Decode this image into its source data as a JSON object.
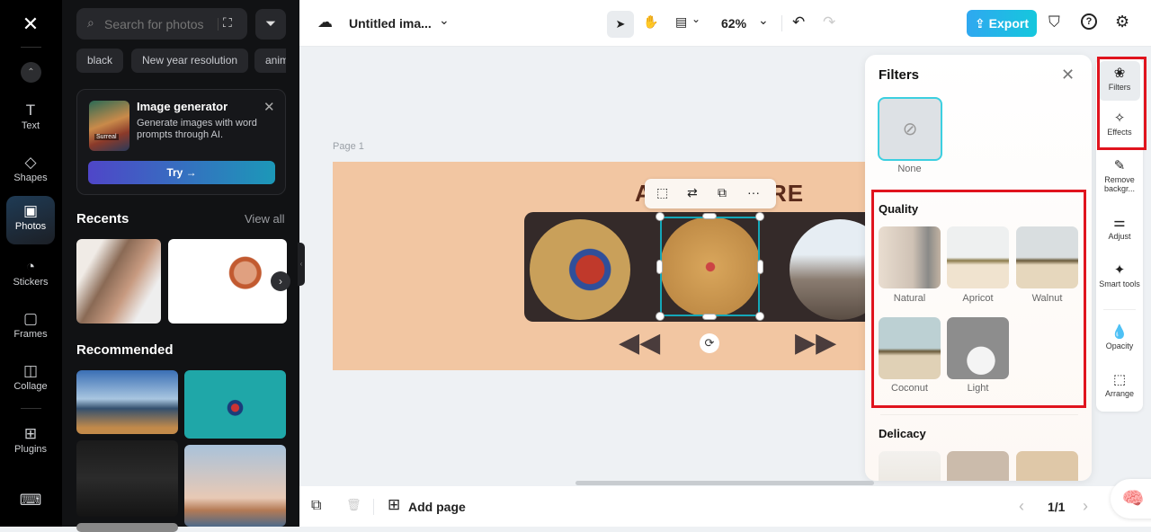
{
  "rail": {
    "items": [
      {
        "label": "Text",
        "icon": "T"
      },
      {
        "label": "Shapes",
        "icon": "◇"
      },
      {
        "label": "Photos",
        "icon": "▣"
      },
      {
        "label": "Stickers",
        "icon": "◔"
      },
      {
        "label": "Frames",
        "icon": "▢"
      },
      {
        "label": "Collage",
        "icon": "◫"
      },
      {
        "label": "Plugins",
        "icon": "⊞"
      }
    ],
    "logo": "✕",
    "up": "⌃",
    "keyboard": "⌨"
  },
  "panel": {
    "search": {
      "placeholder": "Search for photos",
      "icon": "⌕",
      "camera": "⛶"
    },
    "filter_icon": "⏷",
    "chips": [
      "black",
      "New year resolution",
      "anim"
    ],
    "generator": {
      "title": "Image generator",
      "desc": "Generate images with word prompts through AI.",
      "try": "Try →",
      "close": "✕",
      "badge": "Surreal"
    },
    "recents_title": "Recents",
    "view_all": "View all",
    "next": "›",
    "recommended_title": "Recommended",
    "collapse": "‹"
  },
  "topbar": {
    "cloud": "☁",
    "title": "Untitled ima...",
    "caret": "⌄",
    "select": "➤",
    "hand": "✋",
    "layout": "▤",
    "zoom": "62%",
    "undo": "↶",
    "redo": "↷",
    "export": "Export",
    "export_icon": "⇪",
    "shield": "⛉",
    "help": "?",
    "settings": "⚙"
  },
  "canvas": {
    "page_label": "Page 1",
    "title_left": "A",
    "title_right": "RE",
    "ctx": [
      "⬚",
      "⇄",
      "⧉",
      "···"
    ],
    "prev": "◀◀",
    "next": "▶▶",
    "rotate": "⟳"
  },
  "filters": {
    "title": "Filters",
    "close": "✕",
    "none_label": "None",
    "none_icon": "⊘",
    "quality_title": "Quality",
    "quality": [
      "Natural",
      "Apricot",
      "Walnut",
      "Coconut",
      "Light"
    ],
    "delicacy_title": "Delicacy"
  },
  "rightrail": {
    "items": [
      {
        "label": "Filters",
        "icon": "❀"
      },
      {
        "label": "Effects",
        "icon": "✧"
      },
      {
        "label": "Remove backgr...",
        "icon": "✎"
      },
      {
        "label": "Adjust",
        "icon": "⚌"
      },
      {
        "label": "Smart tools",
        "icon": "✦"
      },
      {
        "label": "Opacity",
        "icon": "💧"
      },
      {
        "label": "Arrange",
        "icon": "⬚"
      }
    ]
  },
  "bottombar": {
    "duplicate": "⧉",
    "delete": "🗑",
    "add_page": "Add page",
    "add_icon": "⊞",
    "prev": "‹",
    "page": "1/1",
    "next": "›",
    "ai": "🧠"
  }
}
